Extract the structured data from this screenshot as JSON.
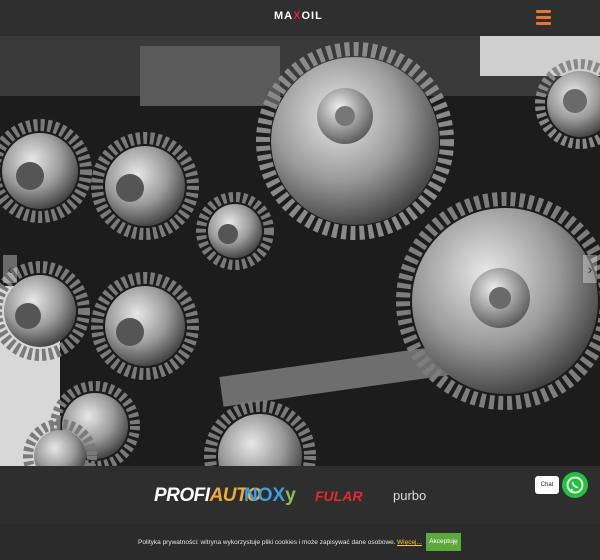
{
  "header": {
    "logo_prefix": "MA",
    "logo_x": "X",
    "logo_suffix": "OIL",
    "menu_icon": "hamburger-icon",
    "accent": "#e8772e"
  },
  "hero": {
    "prev_icon": "chevron-left-icon",
    "next_icon": "chevron-right-icon",
    "prev_glyph": "‹",
    "next_glyph": "›"
  },
  "brands": {
    "profiauto": {
      "part1": "PROFI",
      "part2": "AUTO"
    },
    "noxy": {
      "part1": "NOX",
      "part2": "y"
    },
    "fular": "FULAR",
    "purbo": "purbo"
  },
  "chat": {
    "label": "Chat",
    "icon": "whatsapp-icon",
    "color": "#27c140"
  },
  "cookie": {
    "text": "Polityka prywatności: witryna wykorzystuje pliki cookies i może zapisywać dane osobowe.",
    "link": "Więcej...",
    "accept": "Akceptuję",
    "accept_color": "#5ba83c"
  }
}
